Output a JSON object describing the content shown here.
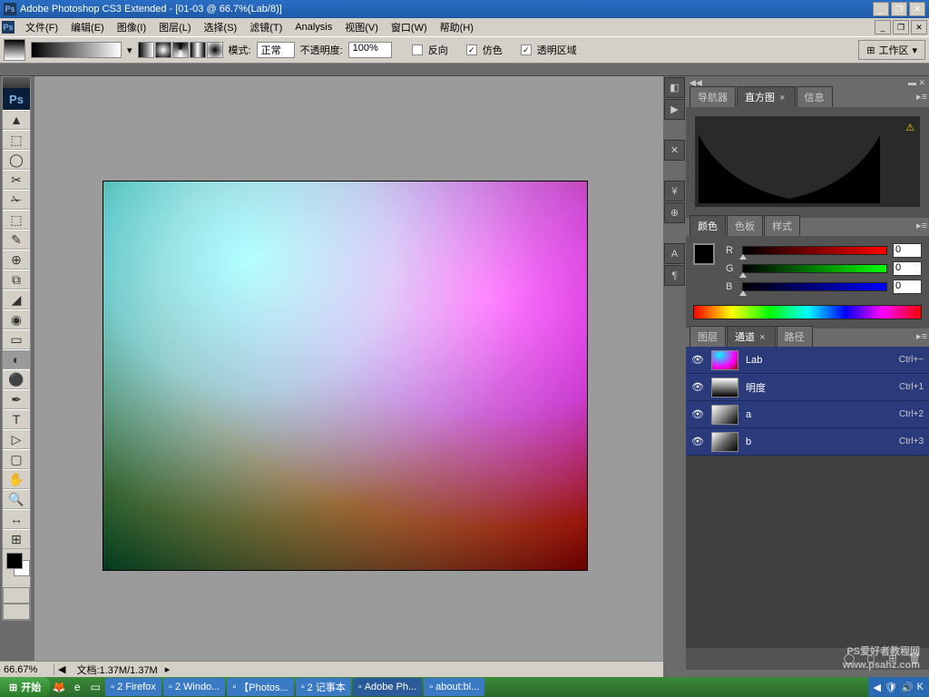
{
  "title": "Adobe Photoshop CS3 Extended - [01-03 @ 66.7%(Lab/8)]",
  "menu": [
    "文件(F)",
    "编辑(E)",
    "图像(I)",
    "图层(L)",
    "选择(S)",
    "滤镜(T)",
    "Analysis",
    "视图(V)",
    "窗口(W)",
    "帮助(H)"
  ],
  "options": {
    "mode_label": "模式:",
    "mode_value": "正常",
    "opacity_label": "不透明度:",
    "opacity_value": "100%",
    "reverse": "反向",
    "dither": "仿色",
    "transparency": "透明区域",
    "workspace": "工作区"
  },
  "panels": {
    "nav_tabs": [
      "导航器",
      "直方图",
      "信息"
    ],
    "color_tabs": [
      "颜色",
      "色板",
      "样式"
    ],
    "color": {
      "r_label": "R",
      "g_label": "G",
      "b_label": "B",
      "r": "0",
      "g": "0",
      "b": "0"
    },
    "layer_tabs": [
      "图层",
      "通道",
      "路径"
    ],
    "channels": [
      {
        "name": "Lab",
        "key": "Ctrl+~",
        "thumb": "lab"
      },
      {
        "name": "明度",
        "key": "Ctrl+1",
        "thumb": "lum"
      },
      {
        "name": "a",
        "key": "Ctrl+2",
        "thumb": "a"
      },
      {
        "name": "b",
        "key": "Ctrl+3",
        "thumb": "b"
      }
    ]
  },
  "status": {
    "zoom": "66.67%",
    "doc": "文档:1.37M/1.37M"
  },
  "taskbar": {
    "start": "开始",
    "items": [
      "2 Firefox",
      "2 Windo...",
      "【Photos...",
      "2 记事本",
      "Adobe Ph...",
      "about:bl..."
    ]
  },
  "watermark": {
    "line1": "PS爱好者教程网",
    "line2": "www.psahz.com"
  },
  "tools": [
    "▲",
    "⬚",
    "◯",
    "✂",
    "✁",
    "⬚",
    "✎",
    "⊕",
    "⧉",
    "◢",
    "◉",
    "▭",
    "◐",
    "⚫",
    "✒",
    "T",
    "▷",
    "▢",
    "✋",
    "🔍",
    "↔",
    "⊞"
  ]
}
